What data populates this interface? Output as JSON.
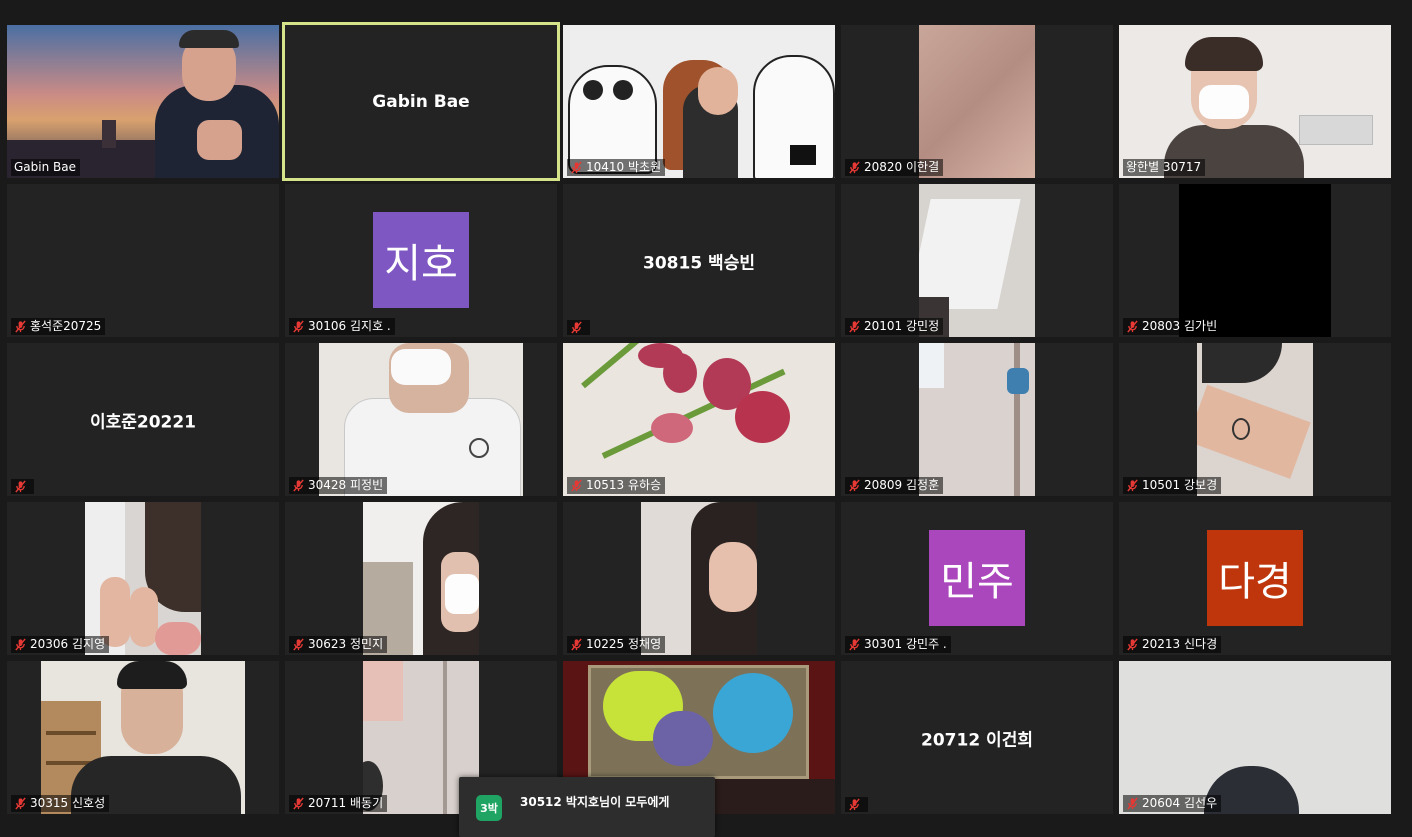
{
  "tiles": [
    {
      "id": "t00",
      "name": "Gabin Bae",
      "mic": false,
      "kind": "video",
      "scene": "gabin"
    },
    {
      "id": "t01",
      "name": "Gabin Bae",
      "kind": "name",
      "active": true
    },
    {
      "id": "t02",
      "name": "10410 박초원",
      "mic": true,
      "kind": "video",
      "scene": "bears"
    },
    {
      "id": "t03",
      "name": "20820 이한결",
      "mic": true,
      "kind": "video",
      "scene": "palm"
    },
    {
      "id": "t04",
      "name": "왕한별 30717",
      "mic": false,
      "kind": "video",
      "scene": "mask-boy"
    },
    {
      "id": "t10",
      "name": "홍석준20725",
      "mic": true,
      "kind": "blank"
    },
    {
      "id": "t11",
      "name": "30106 김지호 .",
      "mic": true,
      "kind": "avatar",
      "avatar_text": "지호",
      "avatar_color": "#7e57c2"
    },
    {
      "id": "t12",
      "display": "30815 백승빈",
      "name": "",
      "mic": true,
      "kind": "name"
    },
    {
      "id": "t13",
      "name": "20101 강민정",
      "mic": true,
      "kind": "video",
      "scene": "ceiling"
    },
    {
      "id": "t14",
      "name": "20803 김가빈",
      "mic": true,
      "kind": "video",
      "scene": "black"
    },
    {
      "id": "t20",
      "display": "이호준20221",
      "name": "",
      "mic": true,
      "kind": "name"
    },
    {
      "id": "t21",
      "name": "30428 피정빈",
      "mic": true,
      "kind": "video",
      "scene": "student-desk"
    },
    {
      "id": "t22",
      "name": "10513 유하승",
      "mic": true,
      "kind": "video",
      "scene": "tulips"
    },
    {
      "id": "t23",
      "name": "20809 김정훈",
      "mic": true,
      "kind": "video",
      "scene": "room"
    },
    {
      "id": "t24",
      "name": "10501 강보경",
      "mic": true,
      "kind": "video",
      "scene": "arm"
    },
    {
      "id": "t30",
      "name": "20306 김지영",
      "mic": true,
      "kind": "video",
      "scene": "peace"
    },
    {
      "id": "t31",
      "name": "30623 정민지",
      "mic": true,
      "kind": "video",
      "scene": "girl-mask"
    },
    {
      "id": "t32",
      "name": "10225 정채영",
      "mic": true,
      "kind": "video",
      "scene": "girl-smile"
    },
    {
      "id": "t33",
      "name": "30301 강민주 .",
      "mic": true,
      "kind": "avatar",
      "avatar_text": "민주",
      "avatar_color": "#ab47bc"
    },
    {
      "id": "t34",
      "name": "20213 신다경",
      "mic": true,
      "kind": "avatar",
      "avatar_text": "다경",
      "avatar_color": "#bf360c"
    },
    {
      "id": "t40",
      "name": "30315 신호성",
      "mic": true,
      "kind": "video",
      "scene": "nike-boy"
    },
    {
      "id": "t41",
      "name": "20711 배동기",
      "mic": true,
      "kind": "video",
      "scene": "wall"
    },
    {
      "id": "t42",
      "name": "",
      "mic": false,
      "kind": "video",
      "scene": "theater"
    },
    {
      "id": "t43",
      "display": "20712 이건희",
      "name": "",
      "mic": true,
      "kind": "name"
    },
    {
      "id": "t44",
      "name": "20604 김선우",
      "mic": true,
      "kind": "video",
      "scene": "ceiling-head"
    }
  ],
  "chat_popup": {
    "avatar_text": "3박",
    "message": "30512 박지호님이 모두에게",
    "sub": "..."
  },
  "colors": {
    "active_border": "#d5e38b",
    "tile_bg": "#232323",
    "page_bg": "#1a1a1a",
    "mic_muted": "#e53935"
  }
}
